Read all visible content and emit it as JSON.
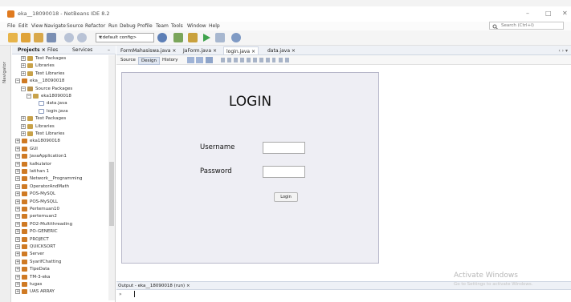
{
  "window": {
    "title": "eka__18090018 - NetBeans IDE 8.2",
    "minimize": "–",
    "maximize": "□",
    "close": "✕"
  },
  "menu": {
    "items": [
      "File",
      "Edit",
      "View",
      "Navigate",
      "Source",
      "Refactor",
      "Run",
      "Debug",
      "Profile",
      "Team",
      "Tools",
      "Window",
      "Help"
    ],
    "search_placeholder": "Search (Ctrl+I)"
  },
  "toolbar": {
    "config_value": "<default config>"
  },
  "sidebar": {
    "navigator_label": "Navigator",
    "tabs": [
      "Projects ×",
      "Files",
      "Services"
    ],
    "minimize_glyph": "–"
  },
  "tree": [
    {
      "indent": 1,
      "exp": "+",
      "icon": "pkg",
      "label": "Test Packages"
    },
    {
      "indent": 1,
      "exp": "+",
      "icon": "pkg",
      "label": "Libraries"
    },
    {
      "indent": 1,
      "exp": "+",
      "icon": "pkg",
      "label": "Test Libraries"
    },
    {
      "indent": 0,
      "exp": "−",
      "icon": "proj",
      "label": "eka__18090018"
    },
    {
      "indent": 1,
      "exp": "−",
      "icon": "src",
      "label": "Source Packages"
    },
    {
      "indent": 2,
      "exp": "−",
      "icon": "pkg",
      "label": "eka18090018"
    },
    {
      "indent": 3,
      "exp": "",
      "icon": "file",
      "label": "data.java"
    },
    {
      "indent": 3,
      "exp": "",
      "icon": "file",
      "label": "login.java"
    },
    {
      "indent": 1,
      "exp": "+",
      "icon": "pkg",
      "label": "Test Packages"
    },
    {
      "indent": 1,
      "exp": "+",
      "icon": "pkg",
      "label": "Libraries"
    },
    {
      "indent": 1,
      "exp": "+",
      "icon": "pkg",
      "label": "Test Libraries"
    },
    {
      "indent": 0,
      "exp": "+",
      "icon": "proj",
      "label": "eka18090018"
    },
    {
      "indent": 0,
      "exp": "+",
      "icon": "proj",
      "label": "GUI"
    },
    {
      "indent": 0,
      "exp": "+",
      "icon": "proj",
      "label": "JavaApplication1"
    },
    {
      "indent": 0,
      "exp": "+",
      "icon": "proj",
      "label": "kalkulator"
    },
    {
      "indent": 0,
      "exp": "+",
      "icon": "proj",
      "label": "latihan 1"
    },
    {
      "indent": 0,
      "exp": "+",
      "icon": "proj",
      "label": "Network__Programming"
    },
    {
      "indent": 0,
      "exp": "+",
      "icon": "proj",
      "label": "OperatorAndMath"
    },
    {
      "indent": 0,
      "exp": "+",
      "icon": "proj",
      "label": "POS-MySQL"
    },
    {
      "indent": 0,
      "exp": "+",
      "icon": "proj",
      "label": "POS-MySQLL"
    },
    {
      "indent": 0,
      "exp": "+",
      "icon": "proj",
      "label": "Pertemuan10"
    },
    {
      "indent": 0,
      "exp": "+",
      "icon": "proj",
      "label": "pertemuan2"
    },
    {
      "indent": 0,
      "exp": "+",
      "icon": "proj",
      "label": "PO2-Multithreading"
    },
    {
      "indent": 0,
      "exp": "+",
      "icon": "proj",
      "label": "PO-GENERIC"
    },
    {
      "indent": 0,
      "exp": "+",
      "icon": "proj",
      "label": "PROJECT"
    },
    {
      "indent": 0,
      "exp": "+",
      "icon": "proj",
      "label": "QUICKSORT"
    },
    {
      "indent": 0,
      "exp": "+",
      "icon": "proj",
      "label": "Server"
    },
    {
      "indent": 0,
      "exp": "+",
      "icon": "proj",
      "label": "SyarifChatting"
    },
    {
      "indent": 0,
      "exp": "+",
      "icon": "proj",
      "label": "TipeData"
    },
    {
      "indent": 0,
      "exp": "+",
      "icon": "proj",
      "label": "TM-3-eka"
    },
    {
      "indent": 0,
      "exp": "+",
      "icon": "proj",
      "label": "tugas"
    },
    {
      "indent": 0,
      "exp": "+",
      "icon": "proj",
      "label": "UAS ARRAY"
    }
  ],
  "editor": {
    "tabs": [
      "FormMahasiswa.java ×",
      "JaForm.java ×",
      "login.java ×",
      "data.java ×"
    ],
    "active_tab": 2,
    "view_buttons": [
      "Source",
      "Design",
      "History"
    ],
    "active_view": 1
  },
  "form": {
    "title": "LOGIN",
    "username_label": "Username",
    "password_label": "Password",
    "username_value": "",
    "password_value": "",
    "login_button": "Login"
  },
  "output": {
    "tab_label": "Output - eka__18090018 (run)  ×",
    "prompt": "»"
  },
  "watermark": {
    "line1": "Activate Windows",
    "line2": "Go to Settings to activate Windows."
  }
}
